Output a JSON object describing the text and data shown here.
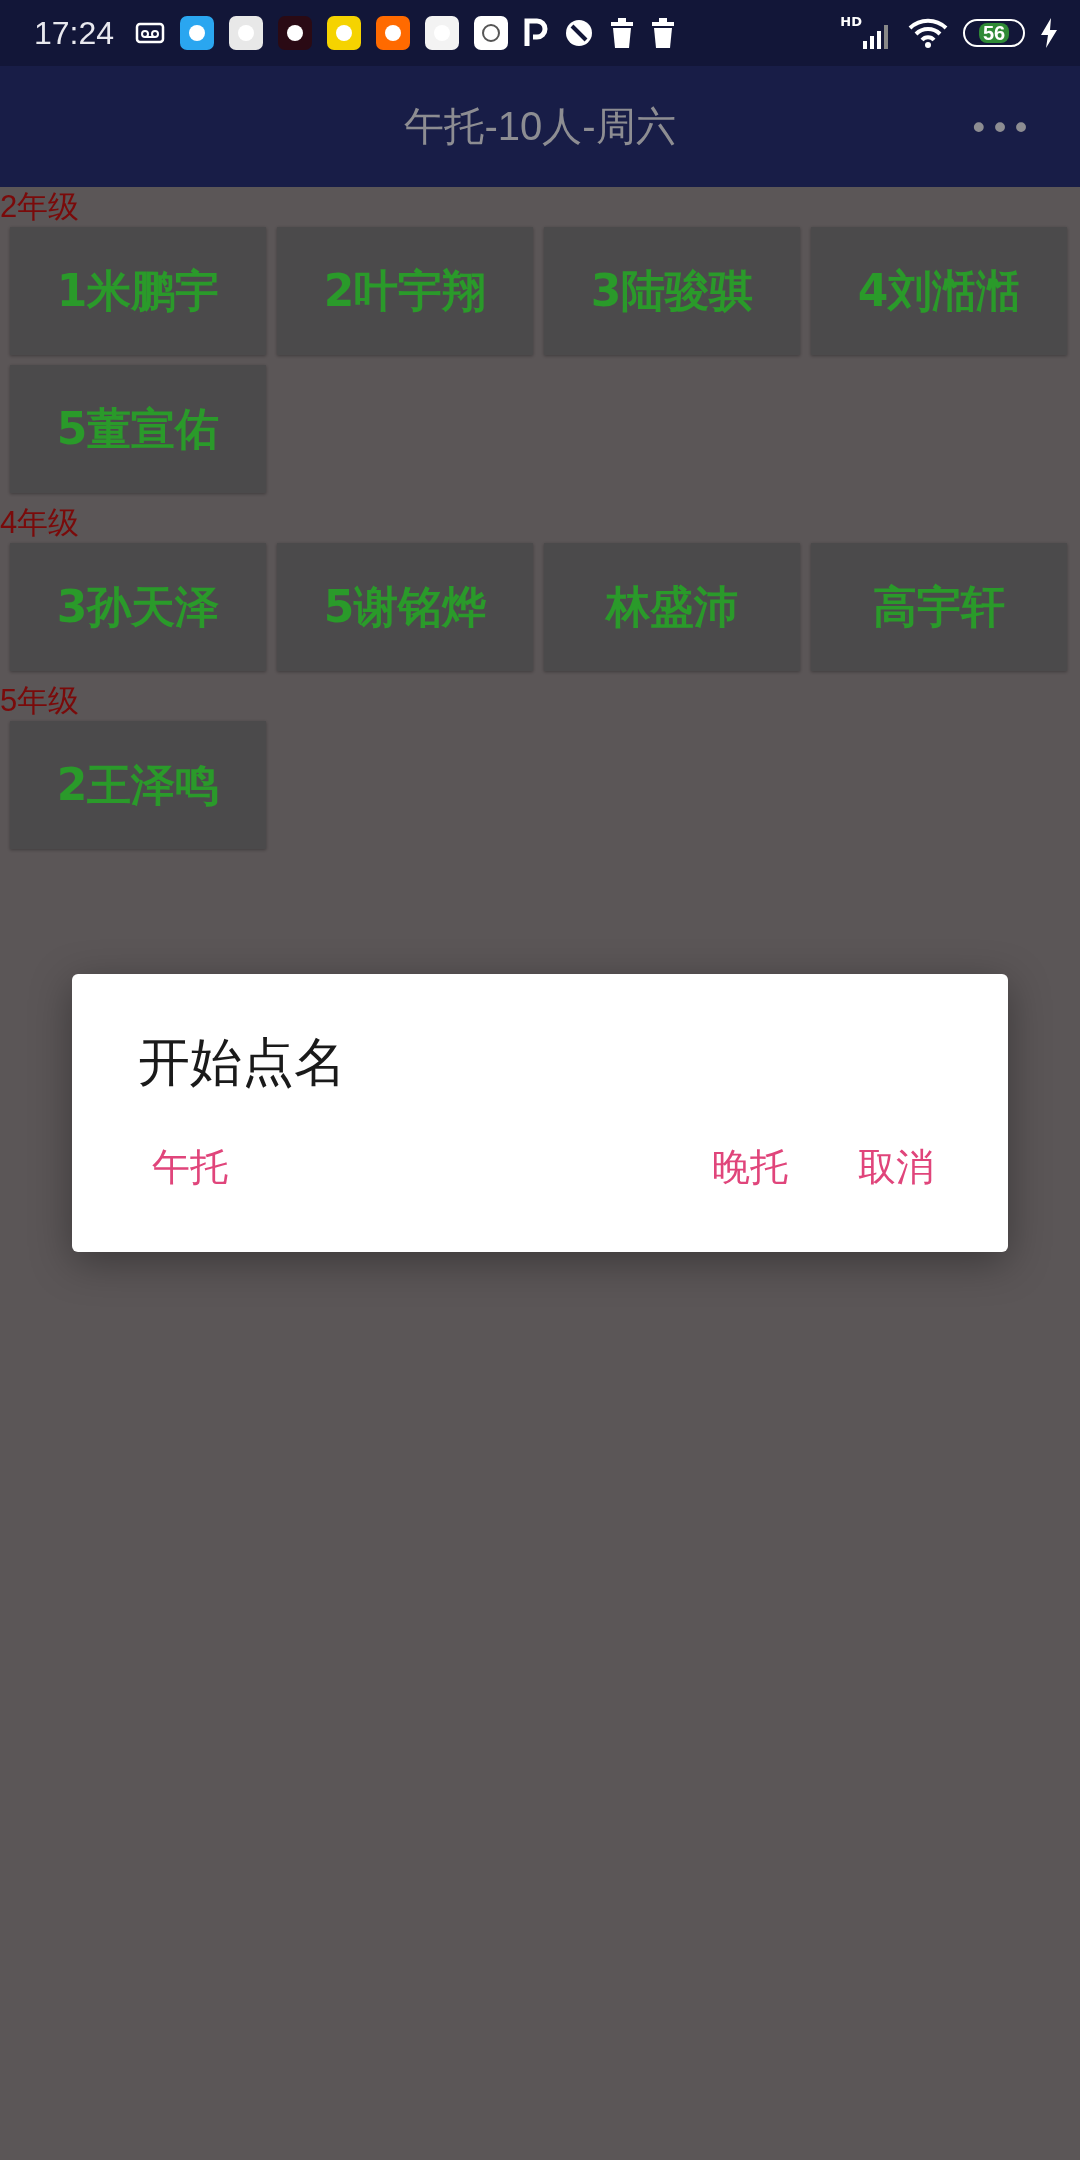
{
  "status_bar": {
    "time": "17:24",
    "network": "HD",
    "battery": "56"
  },
  "app_bar": {
    "title": "午托-10人-周六",
    "menu": "•••"
  },
  "groups": [
    {
      "label": "2年级",
      "students": [
        "1米鹏宇",
        "2叶宇翔",
        "3陆骏骐",
        "4刘湉湉",
        "5董宣佑"
      ]
    },
    {
      "label": "4年级",
      "students": [
        "3孙天泽",
        "5谢铭烨",
        "林盛沛",
        "高宇轩"
      ]
    },
    {
      "label": "5年级",
      "students": [
        "2王泽鸣"
      ]
    }
  ],
  "dialog": {
    "title": "开始点名",
    "buttons": [
      "午托",
      "晚托",
      "取消"
    ]
  }
}
